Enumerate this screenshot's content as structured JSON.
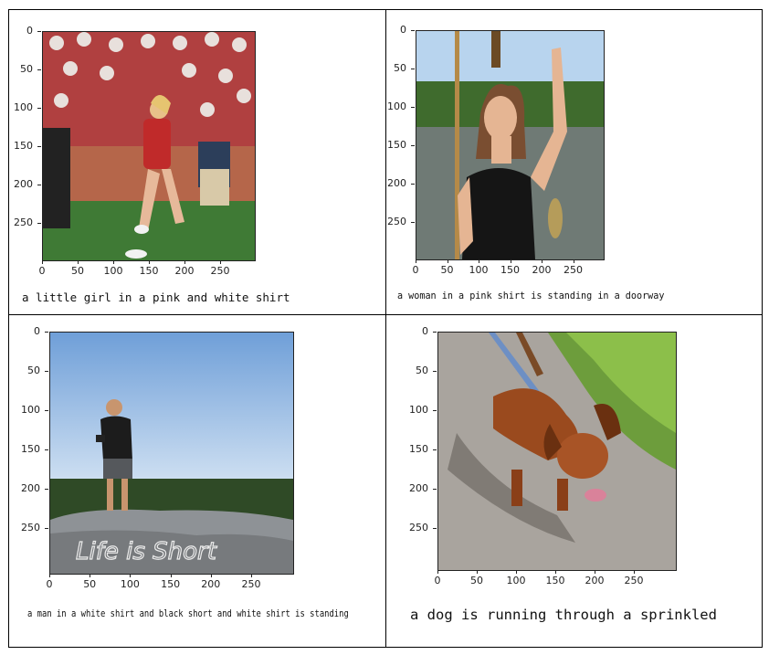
{
  "panels": [
    {
      "caption": "a little girl in a pink and white shirt",
      "yticks": [
        "0",
        "50",
        "100",
        "150",
        "200",
        "250"
      ],
      "xticks": [
        "0",
        "50",
        "100",
        "150",
        "200",
        "250"
      ]
    },
    {
      "caption": "a woman in a pink shirt is standing in a doorway",
      "yticks": [
        "0",
        "50",
        "100",
        "150",
        "200",
        "250"
      ],
      "xticks": [
        "0",
        "50",
        "100",
        "150",
        "200",
        "250"
      ]
    },
    {
      "caption": "a man in a white shirt and black short and white shirt is standing",
      "yticks": [
        "0",
        "50",
        "100",
        "150",
        "200",
        "250"
      ],
      "xticks": [
        "0",
        "50",
        "100",
        "150",
        "200",
        "250"
      ]
    },
    {
      "caption": "a dog is running through a sprinkled",
      "yticks": [
        "0",
        "50",
        "100",
        "150",
        "200",
        "250"
      ],
      "xticks": [
        "0",
        "50",
        "100",
        "150",
        "200",
        "250"
      ]
    }
  ],
  "rock_text": "Life is Short"
}
